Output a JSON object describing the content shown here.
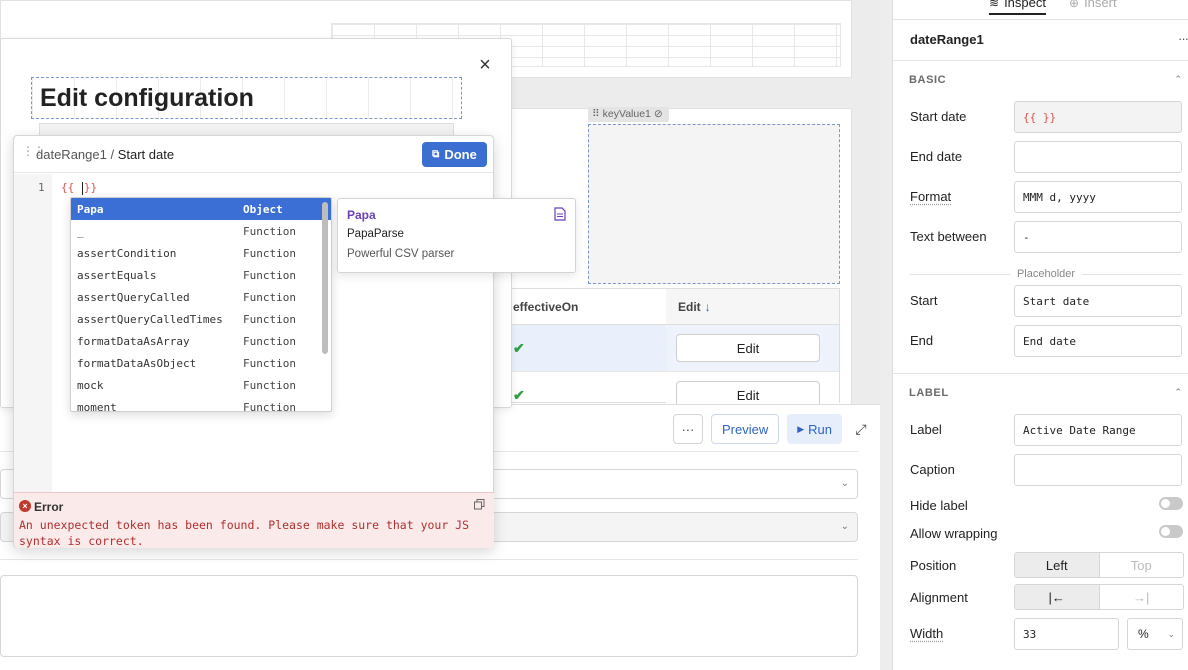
{
  "canvas": {
    "keyvalue_tag": "keyValue1",
    "table": {
      "headers": [
        "effectiveOn",
        "Edit"
      ],
      "rows": [
        {
          "check": "✔",
          "action": "Edit"
        },
        {
          "check": "✔",
          "action": "Edit"
        }
      ]
    }
  },
  "edit_config": {
    "title": "Edit configuration",
    "close": "×"
  },
  "code_popover": {
    "breadcrumb_parent": "dateRange1",
    "breadcrumb_sep": " / ",
    "breadcrumb_current": "Start date",
    "done_label": "Done",
    "line_number": "1",
    "code_left": "{{ ",
    "code_right": "}}"
  },
  "autocomplete": {
    "items": [
      {
        "name": "Papa",
        "type": "Object"
      },
      {
        "name": "_",
        "type": "Function"
      },
      {
        "name": "assertCondition",
        "type": "Function"
      },
      {
        "name": "assertEquals",
        "type": "Function"
      },
      {
        "name": "assertQueryCalled",
        "type": "Function"
      },
      {
        "name": "assertQueryCalledTimes",
        "type": "Function"
      },
      {
        "name": "formatDataAsArray",
        "type": "Function"
      },
      {
        "name": "formatDataAsObject",
        "type": "Function"
      },
      {
        "name": "mock",
        "type": "Function"
      },
      {
        "name": "moment",
        "type": "Function"
      }
    ],
    "doc": {
      "name": "Papa",
      "subtitle": "PapaParse",
      "description": "Powerful CSV parser"
    }
  },
  "error": {
    "title": "Error",
    "message": "An unexpected token has been found. Please make sure that your JS syntax is correct."
  },
  "query_toolbar": {
    "more": "···",
    "preview": "Preview",
    "run": "Run"
  },
  "inspector": {
    "tabs": {
      "inspect": "Inspect",
      "insert": "Insert"
    },
    "component_name": "dateRange1",
    "more": "···",
    "basic": {
      "title": "BASIC",
      "start_date_label": "Start date",
      "start_date_value": "{{ }}",
      "end_date_label": "End date",
      "end_date_value": "",
      "format_label": "Format",
      "format_value": "MMM d, yyyy",
      "text_between_label": "Text between",
      "text_between_value": "-",
      "placeholder_heading": "Placeholder",
      "start_label": "Start",
      "start_value": "Start date",
      "end_label": "End",
      "end_value": "End date"
    },
    "label": {
      "title": "LABEL",
      "label_label": "Label",
      "label_value": "Active Date Range",
      "caption_label": "Caption",
      "caption_value": "",
      "hide_label_label": "Hide label",
      "hide_label_on": false,
      "allow_wrapping_label": "Allow wrapping",
      "allow_wrapping_on": false,
      "position_label": "Position",
      "position_options": [
        "Left",
        "Top"
      ],
      "position_selected": "Left",
      "alignment_label": "Alignment",
      "alignment_options": [
        "|←",
        "→|"
      ],
      "width_label": "Width",
      "width_value": "33",
      "width_unit": "%"
    }
  },
  "colors": {
    "accent": "#3a6fd1",
    "error": "#b22f2f",
    "doc_name": "#6a3fb9",
    "check": "#2f9e44"
  }
}
